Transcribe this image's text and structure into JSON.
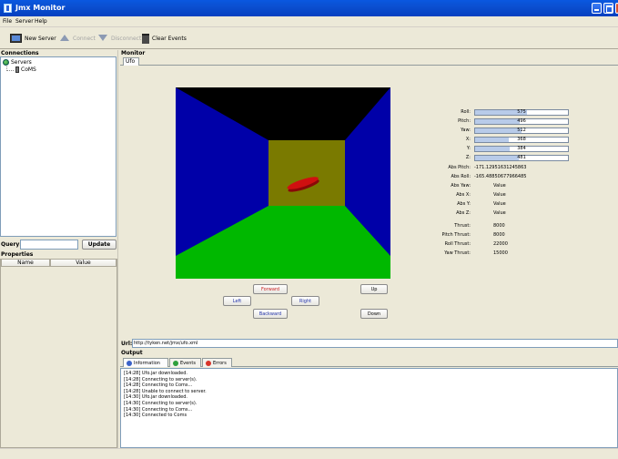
{
  "window": {
    "title": "Jmx Monitor"
  },
  "menu": {
    "file": "File",
    "server": "Server",
    "help": "Help"
  },
  "toolbar": {
    "new_server": "New Server",
    "connect": "Connect",
    "disconnect": "Disconnect",
    "clear_events": "Clear Events"
  },
  "connections": {
    "header": "Connections",
    "root": "Servers",
    "child": "CoMS"
  },
  "query": {
    "label": "Query:",
    "value": "",
    "button": "Update"
  },
  "properties": {
    "header": "Properties",
    "columns": [
      "Name",
      "Value"
    ]
  },
  "monitor": {
    "header": "Monitor",
    "tab": "Ufo",
    "sliders": [
      {
        "label": "Roll:",
        "value": "575",
        "fraction": 0.56
      },
      {
        "label": "Pitch:",
        "value": "496",
        "fraction": 0.48
      },
      {
        "label": "Yaw:",
        "value": "512",
        "fraction": 0.5
      },
      {
        "label": "X:",
        "value": "368",
        "fraction": 0.36
      },
      {
        "label": "Y:",
        "value": "384",
        "fraction": 0.37
      },
      {
        "label": "Z:",
        "value": "481",
        "fraction": 0.47
      }
    ],
    "abs_values": [
      {
        "label": "Abs Pitch:",
        "value": "-171.12951631245863"
      },
      {
        "label": "Abs Roll:",
        "value": "-165.48850677966485"
      },
      {
        "label": "Abs Yaw:",
        "value": "Value"
      },
      {
        "label": "Abs X:",
        "value": "Value"
      },
      {
        "label": "Abs Y:",
        "value": "Value"
      },
      {
        "label": "Abs Z:",
        "value": "Value"
      }
    ],
    "thrusts": [
      {
        "label": "Thrust:",
        "value": "8000"
      },
      {
        "label": "Pitch Thrust:",
        "value": "8000"
      },
      {
        "label": "Roll Thrust:",
        "value": "22000"
      },
      {
        "label": "Yaw Thrust:",
        "value": "15000"
      }
    ],
    "controls": {
      "forward": "Forward",
      "left": "Left",
      "right": "Right",
      "backward": "Backward",
      "up": "Up",
      "down": "Down"
    },
    "scene_colors": {
      "ceiling": "#000000",
      "walls": "#0000a8",
      "floor": "#00b800",
      "back": "#7a7a00",
      "ufo": "#d01010"
    }
  },
  "url": {
    "label": "Url:",
    "value": "http://tyken.net/jmx/ufo.xml"
  },
  "output": {
    "header": "Output",
    "tabs": [
      "Information",
      "Events",
      "Errors"
    ],
    "log": [
      "[14:28] Ufo.jar downloaded.",
      "[14:28] Connecting to server(s).",
      "[14:28] Connecting to Coms...",
      "[14:28] Unable to connect to server.",
      "[14:30] Ufo.jar downloaded.",
      "[14:30] Connecting to server(s).",
      "[14:30] Connecting to Coms...",
      "[14:30] Connected to Coms"
    ]
  }
}
